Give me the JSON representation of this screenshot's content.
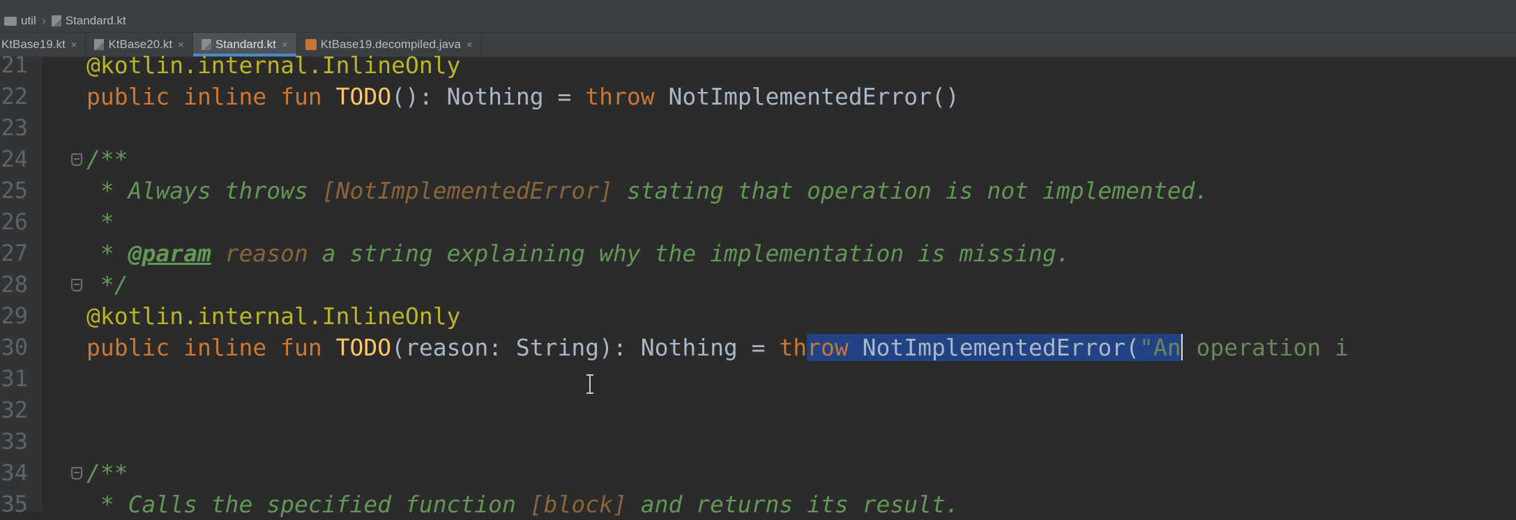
{
  "breadcrumb": {
    "folder": "util",
    "file": "Standard.kt"
  },
  "tabs": [
    {
      "label": "KtBase19.kt",
      "close": "×"
    },
    {
      "label": "KtBase20.kt",
      "close": "×"
    },
    {
      "label": "Standard.kt",
      "close": "×"
    },
    {
      "label": "KtBase19.decompiled.java",
      "close": "×"
    }
  ],
  "active_tab": "Standard.kt",
  "lines": [
    {
      "num": "21",
      "tokens": [
        {
          "t": "@kotlin.internal.InlineOnly",
          "c": "ann"
        }
      ]
    },
    {
      "num": "22",
      "tokens": [
        {
          "t": "public inline fun ",
          "c": "kw"
        },
        {
          "t": "TODO",
          "c": "fn"
        },
        {
          "t": "(): Nothing = ",
          "c": "tx"
        },
        {
          "t": "throw ",
          "c": "kw"
        },
        {
          "t": "NotImplementedError()",
          "c": "tx"
        }
      ]
    },
    {
      "num": "23",
      "tokens": []
    },
    {
      "num": "24",
      "tokens": [
        {
          "t": "/**",
          "c": "doc"
        }
      ]
    },
    {
      "num": "25",
      "tokens": [
        {
          "t": " * Always throws ",
          "c": "doc"
        },
        {
          "t": "[NotImplementedError]",
          "c": "docref"
        },
        {
          "t": " stating that operation is not implemented.",
          "c": "doc"
        }
      ]
    },
    {
      "num": "26",
      "tokens": [
        {
          "t": " *",
          "c": "doc"
        }
      ]
    },
    {
      "num": "27",
      "tokens": [
        {
          "t": " * ",
          "c": "doc"
        },
        {
          "t": "@param",
          "c": "doctag"
        },
        {
          "t": " reason",
          "c": "docparam"
        },
        {
          "t": " a string explaining why the implementation is missing.",
          "c": "doc"
        }
      ]
    },
    {
      "num": "28",
      "tokens": [
        {
          "t": " */",
          "c": "doc"
        }
      ]
    },
    {
      "num": "29",
      "tokens": [
        {
          "t": "@kotlin.internal.InlineOnly",
          "c": "ann"
        }
      ]
    },
    {
      "num": "30",
      "tokens": [
        {
          "t": "public inline fun ",
          "c": "kw"
        },
        {
          "t": "TODO",
          "c": "fn"
        },
        {
          "t": "(reason: String): Nothing = ",
          "c": "tx"
        },
        {
          "t": "th",
          "c": "kw"
        },
        {
          "t": "row ",
          "c": "kw sel"
        },
        {
          "t": "NotImplementedError(",
          "c": "tx sel"
        },
        {
          "t": "\"An",
          "c": "str sel"
        },
        {
          "t": "",
          "c": "caret"
        },
        {
          "t": " operation i",
          "c": "str"
        }
      ]
    },
    {
      "num": "31",
      "tokens": []
    },
    {
      "num": "32",
      "tokens": []
    },
    {
      "num": "33",
      "tokens": []
    },
    {
      "num": "34",
      "tokens": [
        {
          "t": "/**",
          "c": "doc"
        }
      ]
    },
    {
      "num": "35",
      "tokens": [
        {
          "t": " * Calls the specified function ",
          "c": "doc"
        },
        {
          "t": "[block]",
          "c": "docref"
        },
        {
          "t": " and returns its result.",
          "c": "doc"
        }
      ]
    }
  ],
  "colors": {
    "background": "#2b2b2b",
    "keyword": "#cc7832",
    "annotation": "#bbb529",
    "function": "#ffc66d",
    "doc_comment": "#629755",
    "selection": "#214283",
    "tab_underline": "#4a88c7"
  }
}
